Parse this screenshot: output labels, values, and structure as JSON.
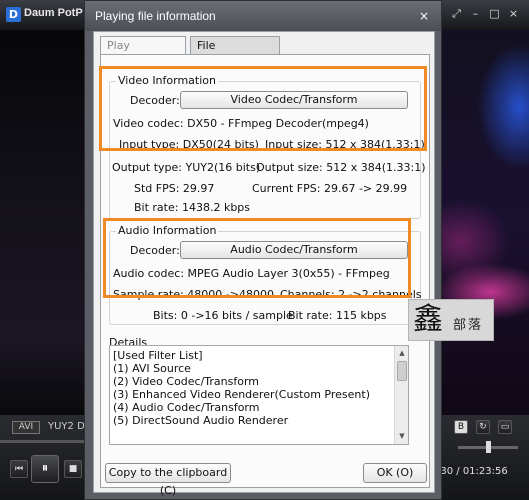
{
  "player": {
    "logo": "D",
    "app_name": "Daum PotP",
    "format_badge": "AVI",
    "format_text": "YUY2 D",
    "time": ":30 / 01:23:56",
    "title_icons": [
      "fullscreen-icon",
      "minimize-icon",
      "maximize-icon",
      "close-icon"
    ],
    "title_icon_glyphs": [
      "⤢",
      "–",
      "□",
      "×"
    ],
    "transport_glyphs": {
      "prev": "⏮",
      "play": "⏸",
      "stop": "■",
      "b_badge": "B",
      "repeat": "↻",
      "pip": "▭"
    },
    "volume_fraction": 0.47
  },
  "dialog": {
    "title": "Playing file information",
    "close_glyph": "×",
    "tabs": [
      {
        "label": "Play information",
        "active": false
      },
      {
        "label": "File Information",
        "active": true
      }
    ],
    "video": {
      "group_label": "Video Information",
      "decoder_label": "Decoder:",
      "decoder_button": "Video Codec/Transform",
      "codec_line": "Video codec: DX50 - FFmpeg Decoder(mpeg4)",
      "input_type": "Input type: DX50(24 bits)",
      "input_size": "Input size: 512 x 384(1.33:1)",
      "output_type": "Output type: YUY2(16 bits)",
      "output_size": "Output size: 512 x 384(1.33:1)",
      "std_fps": "Std FPS: 29.97",
      "current_fps": "Current FPS: 29.67 -> 29.99",
      "bit_rate": "Bit rate: 1438.2 kbps"
    },
    "audio": {
      "group_label": "Audio Information",
      "decoder_label": "Decoder:",
      "decoder_button": "Audio Codec/Transform",
      "codec_line": "Audio codec: MPEG Audio Layer 3(0x55) - FFmpeg",
      "sample_rate": "Sample rate: 48000 ->48000",
      "channels": "Channels: 2 ->2 channels",
      "bits": "Bits: 0 ->16 bits / sample",
      "bit_rate": "Bit rate: 115 kbps"
    },
    "details": {
      "group_label": "Details",
      "lines": [
        "[Used Filter List]",
        "(1) AVI Source",
        "(2) Video Codec/Transform",
        "(3) Enhanced Video Renderer(Custom Present)",
        "(4) Audio Codec/Transform",
        "(5) DirectSound Audio Renderer"
      ]
    },
    "copy_button": "Copy to the clipboard (C)",
    "ok_button": "OK (O)"
  },
  "watermark": {
    "big": "鑫",
    "small": "部落"
  },
  "colors": {
    "highlight": "#f08a24",
    "dialog_title": "#5a5d63"
  }
}
